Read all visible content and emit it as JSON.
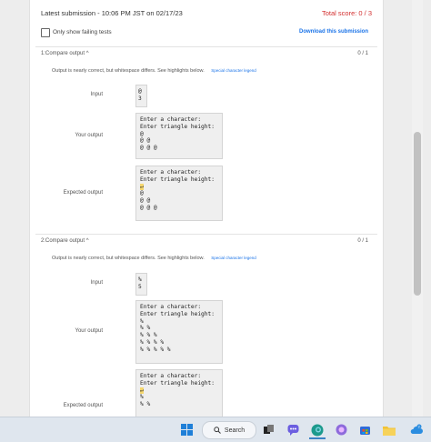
{
  "header": {
    "submission": "Latest submission - 10:06 PM JST on 02/17/23",
    "total_score": "Total score: 0 / 3"
  },
  "filter": {
    "label": "Only show failing tests",
    "download": "Download this submission"
  },
  "tests": [
    {
      "title": "1:Compare output ^",
      "score": "0 / 1",
      "message": "Output is nearly correct, but whitespace differs. See highlights below.",
      "legend": "Special character legend",
      "input_label": "Input",
      "input_lines": [
        "@",
        "3"
      ],
      "your_output_label": "Your output",
      "your_output_lines": [
        "Enter a character:",
        "Enter triangle height:",
        "@",
        "@ @",
        "@ @ @"
      ],
      "expected_label": "Expected output",
      "expected_lines": [
        "Enter a character:",
        "Enter triangle height:",
        "↵",
        "@",
        "@ @",
        "@ @ @"
      ]
    },
    {
      "title": "2:Compare output ^",
      "score": "0 / 1",
      "message": "Output is nearly correct, but whitespace differs. See highlights below.",
      "legend": "Special character legend",
      "input_label": "Input",
      "input_lines": [
        "%",
        "5"
      ],
      "your_output_label": "Your output",
      "your_output_lines": [
        "Enter a character:",
        "Enter triangle height:",
        "%",
        "% %",
        "% % %",
        "% % % %",
        "% % % % %"
      ],
      "expected_label": "Expected output",
      "expected_lines": [
        "Enter a character:",
        "Enter triangle height:",
        "↵",
        "%",
        "% %"
      ]
    }
  ],
  "taskbar": {
    "search_label": "Search"
  },
  "colors": {
    "score_red": "#d32f2f",
    "link_blue": "#1a73e8",
    "highlight": "#f5d76e"
  }
}
